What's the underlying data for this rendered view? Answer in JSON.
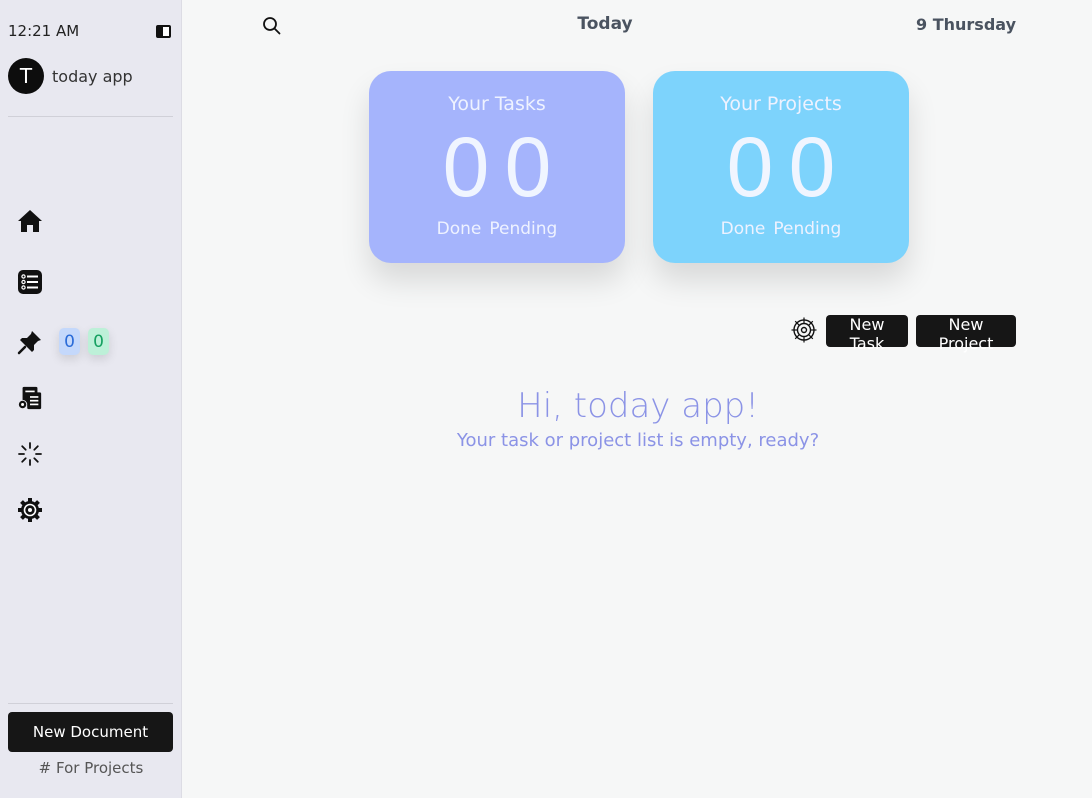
{
  "sidebar": {
    "time": "12:21 AM",
    "user_initial": "T",
    "user_name": "today app",
    "counters": {
      "blue": "0",
      "green": "0"
    },
    "new_document_label": "New Document",
    "for_projects_label": "# For Projects",
    "icons": [
      "home-icon",
      "task-list-icon",
      "pin-icon",
      "document-settings-icon",
      "loading-spinner-icon",
      "settings-gear-icon"
    ]
  },
  "header": {
    "title": "Today",
    "date": "9 Thursday"
  },
  "cards": {
    "tasks": {
      "title": "Your Tasks",
      "done": "0",
      "pending": "0",
      "done_label": "Done",
      "pending_label": "Pending",
      "color": "#a5b4fc"
    },
    "projects": {
      "title": "Your Projects",
      "done": "0",
      "pending": "0",
      "done_label": "Done",
      "pending_label": "Pending",
      "color": "#7dd3fc"
    }
  },
  "actions": {
    "new_task_label": "New Task",
    "new_project_label": "New Project"
  },
  "main": {
    "greeting": "Hi, today app!",
    "empty_message": "Your task or project list is empty, ready?"
  },
  "colors": {
    "accent_text": "#8b93e6",
    "dark_button": "#161616"
  }
}
